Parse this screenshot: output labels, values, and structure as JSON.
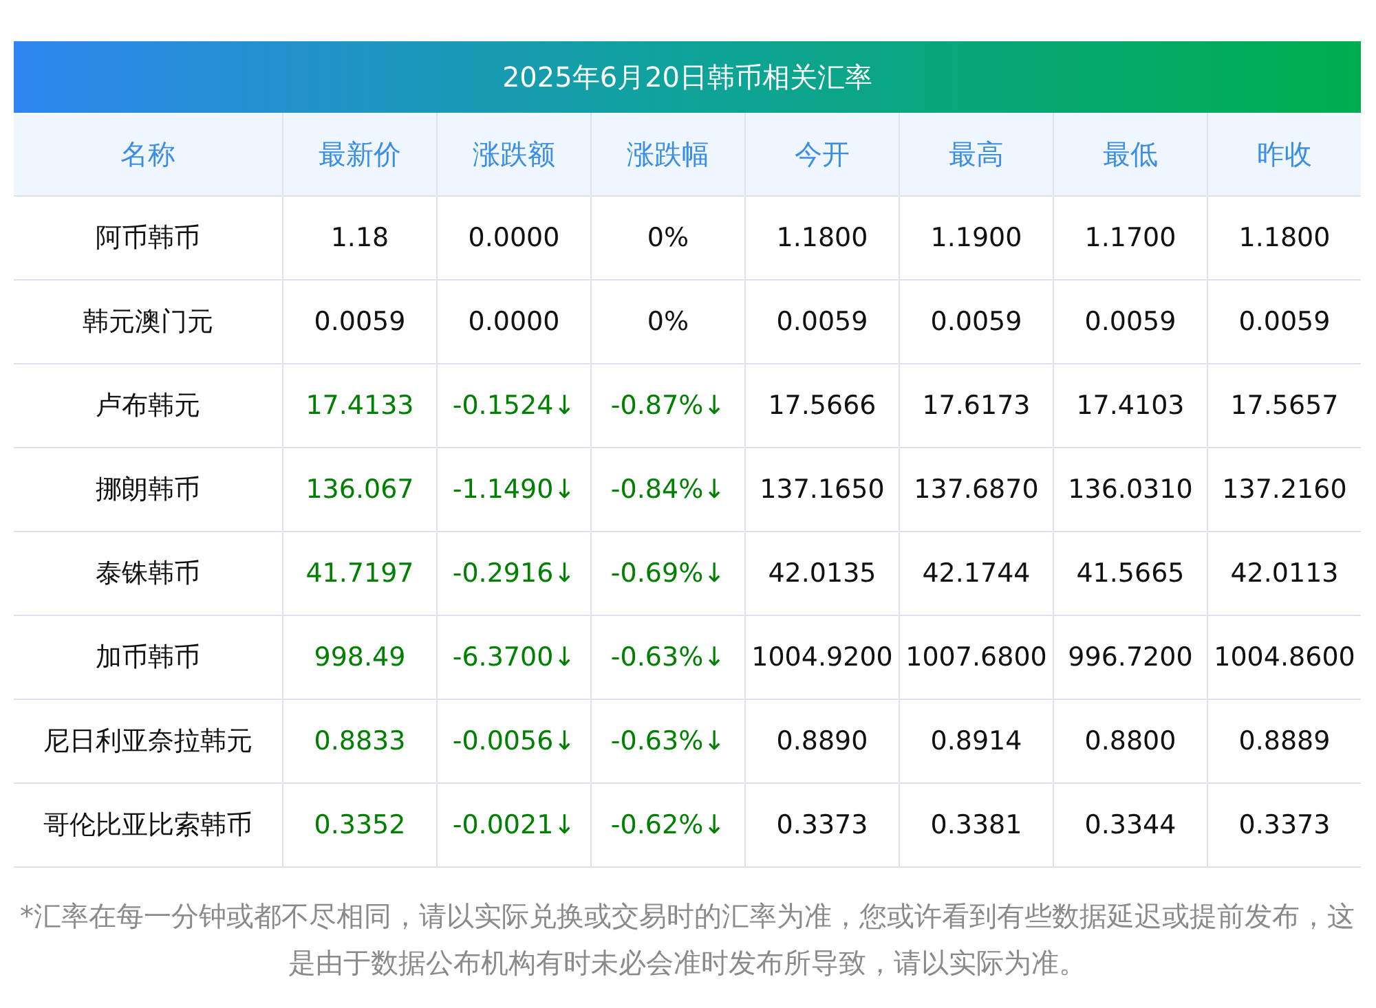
{
  "title": "2025年6月20日韩币相关汇率",
  "columns": [
    "名称",
    "最新价",
    "涨跌额",
    "涨跌幅",
    "今开",
    "最高",
    "最低",
    "昨收"
  ],
  "rows": [
    {
      "kind": "flat",
      "cells": [
        "阿币韩币",
        "1.18",
        "0.0000",
        "0%",
        "1.1800",
        "1.1900",
        "1.1700",
        "1.1800"
      ]
    },
    {
      "kind": "flat",
      "cells": [
        "韩元澳门元",
        "0.0059",
        "0.0000",
        "0%",
        "0.0059",
        "0.0059",
        "0.0059",
        "0.0059"
      ]
    },
    {
      "kind": "down",
      "cells": [
        "卢布韩元",
        "17.4133",
        "-0.1524↓",
        "-0.87%↓",
        "17.5666",
        "17.6173",
        "17.4103",
        "17.5657"
      ]
    },
    {
      "kind": "down",
      "cells": [
        "挪朗韩币",
        "136.067",
        "-1.1490↓",
        "-0.84%↓",
        "137.1650",
        "137.6870",
        "136.0310",
        "137.2160"
      ]
    },
    {
      "kind": "down",
      "cells": [
        "泰铢韩币",
        "41.7197",
        "-0.2916↓",
        "-0.69%↓",
        "42.0135",
        "42.1744",
        "41.5665",
        "42.0113"
      ]
    },
    {
      "kind": "down",
      "cells": [
        "加币韩币",
        "998.49",
        "-6.3700↓",
        "-0.63%↓",
        "1004.9200",
        "1007.6800",
        "996.7200",
        "1004.8600"
      ]
    },
    {
      "kind": "down",
      "cells": [
        "尼日利亚奈拉韩元",
        "0.8833",
        "-0.0056↓",
        "-0.63%↓",
        "0.8890",
        "0.8914",
        "0.8800",
        "0.8889"
      ]
    },
    {
      "kind": "down",
      "cells": [
        "哥伦比亚比索韩币",
        "0.3352",
        "-0.0021↓",
        "-0.62%↓",
        "0.3373",
        "0.3381",
        "0.3344",
        "0.3373"
      ]
    }
  ],
  "note": "*汇率在每一分钟或都不尽相同，请以实际兑换或交易时的汇率为准，您或许看到有些数据延迟或提前发布，这是由于数据公布机构有时未必会准时发布所导致，请以实际为准。"
}
